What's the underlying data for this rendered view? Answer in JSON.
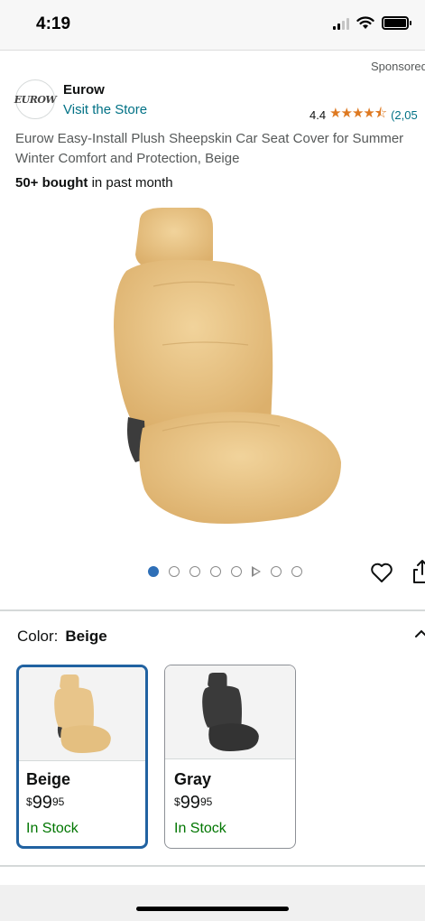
{
  "status_bar": {
    "time": "4:19"
  },
  "ad": {
    "sponsored_label": "Sponsored"
  },
  "brand": {
    "logo_text": "EUROW",
    "name": "Eurow",
    "visit_store": "Visit the Store",
    "rating_value": "4.4",
    "stars": "★★★★⯪",
    "rating_count": "(2,05"
  },
  "product": {
    "title": "Eurow Easy-Install Plush Sheepskin Car Seat Cover for Summer Winter Comfort and Protection, Beige",
    "bought_bold": "50+ bought",
    "bought_rest": " in past month",
    "image_icon": "car-seat-image",
    "carousel_dots": 7,
    "carousel_active_index": 0
  },
  "color_selector": {
    "label": "Color:",
    "selected_value": "Beige",
    "options": [
      {
        "name": "Beige",
        "price_symbol": "$",
        "price_whole": "99",
        "price_cents": "95",
        "stock": "In Stock",
        "swatch_color": "#e8c58a",
        "selected": true
      },
      {
        "name": "Gray",
        "price_symbol": "$",
        "price_whole": "99",
        "price_cents": "95",
        "stock": "In Stock",
        "swatch_color": "#3a3a3a",
        "selected": false
      }
    ]
  },
  "colors": {
    "link": "#007185",
    "stars": "#de7921",
    "in_stock": "#007600",
    "selected_border": "#2162a1",
    "active_dot": "#2e6fb7"
  }
}
